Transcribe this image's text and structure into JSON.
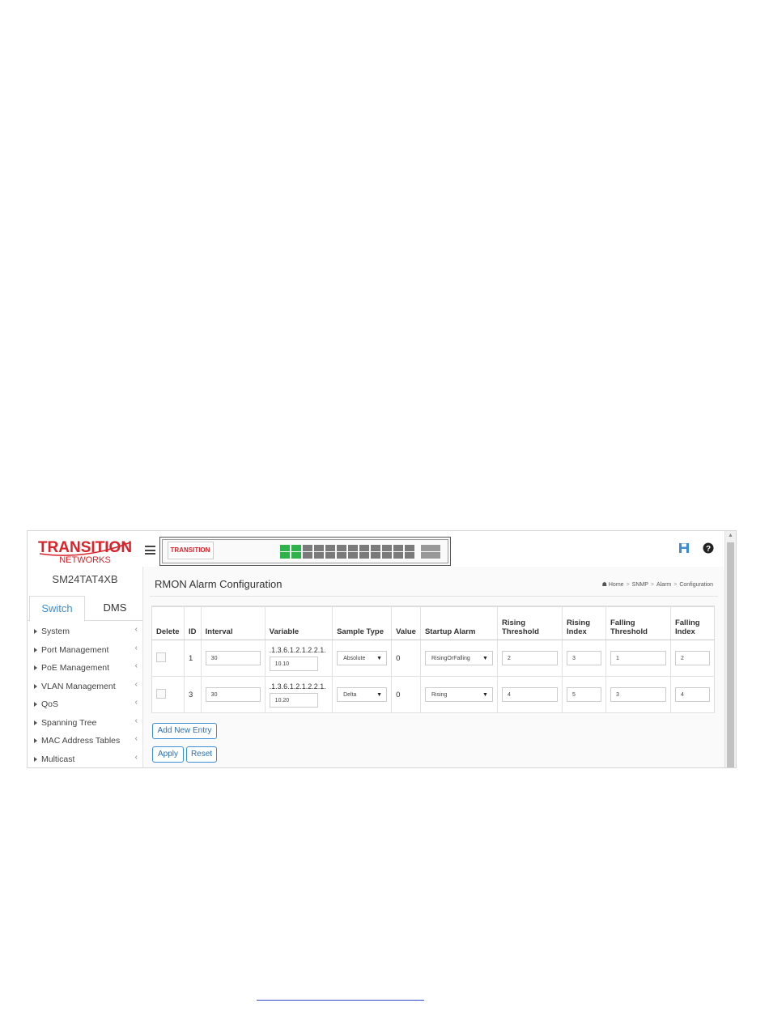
{
  "sidebar": {
    "model": "SM24TAT4XB",
    "tabs": {
      "switch": "Switch",
      "dms": "DMS"
    },
    "items": [
      {
        "label": "System"
      },
      {
        "label": "Port Management"
      },
      {
        "label": "PoE Management"
      },
      {
        "label": "VLAN Management"
      },
      {
        "label": "QoS"
      },
      {
        "label": "Spanning Tree"
      },
      {
        "label": "MAC Address Tables"
      },
      {
        "label": "Multicast"
      }
    ]
  },
  "header": {
    "icons": [
      "save-icon",
      "help-icon",
      "logout-icon"
    ],
    "accent": "#3b8ed6",
    "port_color_active": "#2db34a"
  },
  "page": {
    "title": "RMON Alarm Configuration",
    "breadcrumb": {
      "home": "Home",
      "snmp": "SNMP",
      "alarm": "Alarm",
      "current": "Configuration",
      "sep": ">"
    }
  },
  "table": {
    "headers": {
      "delete": "Delete",
      "id": "ID",
      "interval": "Interval",
      "variable": "Variable",
      "sample_type": "Sample Type",
      "value": "Value",
      "startup_alarm": "Startup Alarm",
      "rising_threshold_1": "Rising",
      "rising_threshold_2": "Threshold",
      "rising_index_1": "Rising",
      "rising_index_2": "Index",
      "falling_threshold_1": "Falling",
      "falling_threshold_2": "Threshold",
      "falling_index_1": "Falling",
      "falling_index_2": "Index"
    },
    "rows": [
      {
        "id": "1",
        "interval": "30",
        "variable_prefix": ".1.3.6.1.2.1.2.2.1.",
        "variable_suffix": "10.10",
        "sample_type": "Absolute",
        "value": "0",
        "startup_alarm": "RisingOrFalling",
        "rising_threshold": "2",
        "rising_index": "3",
        "falling_threshold": "1",
        "falling_index": "2"
      },
      {
        "id": "3",
        "interval": "30",
        "variable_prefix": ".1.3.6.1.2.1.2.2.1.",
        "variable_suffix": "10.20",
        "sample_type": "Delta",
        "value": "0",
        "startup_alarm": "Rising",
        "rising_threshold": "4",
        "rising_index": "5",
        "falling_threshold": "3",
        "falling_index": "4"
      }
    ]
  },
  "buttons": {
    "add": "Add New Entry",
    "apply": "Apply",
    "reset": "Reset"
  },
  "logo": {
    "line1": "TRANSITION",
    "line2": "NETWORKS",
    "mini": "TRANSITION"
  }
}
